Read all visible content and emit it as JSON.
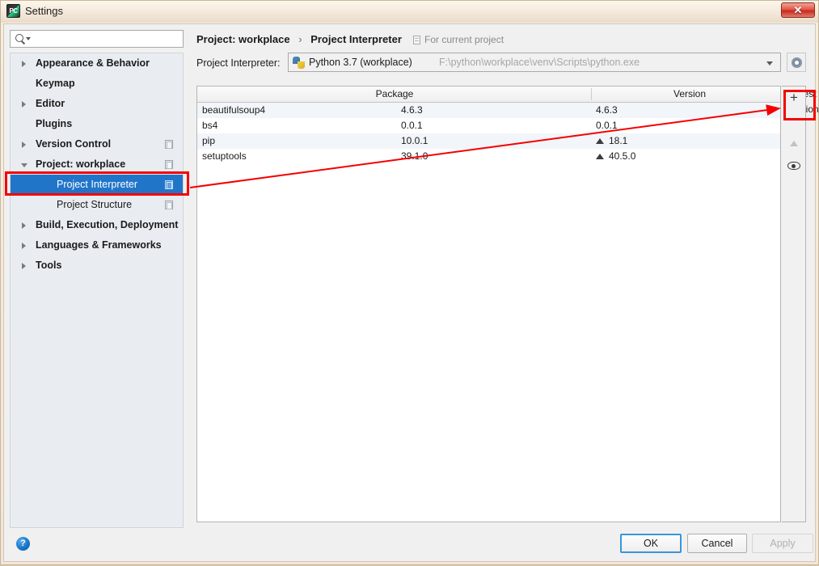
{
  "window": {
    "title": "Settings",
    "app_icon": "pycharm-icon",
    "close_label": "✕"
  },
  "sidebar": {
    "search": {
      "placeholder": "",
      "value": "",
      "icon": "search-icon"
    },
    "items": [
      {
        "label": "Appearance & Behavior",
        "level": 0,
        "arrow": "collapsed",
        "bold": true,
        "scope_icon": false,
        "selected": false
      },
      {
        "label": "Keymap",
        "level": 0,
        "arrow": "none",
        "bold": true,
        "scope_icon": false,
        "selected": false
      },
      {
        "label": "Editor",
        "level": 0,
        "arrow": "collapsed",
        "bold": true,
        "scope_icon": false,
        "selected": false
      },
      {
        "label": "Plugins",
        "level": 0,
        "arrow": "none",
        "bold": true,
        "scope_icon": false,
        "selected": false
      },
      {
        "label": "Version Control",
        "level": 0,
        "arrow": "collapsed",
        "bold": true,
        "scope_icon": true,
        "selected": false
      },
      {
        "label": "Project: workplace",
        "level": 0,
        "arrow": "expanded",
        "bold": true,
        "scope_icon": true,
        "selected": false
      },
      {
        "label": "Project Interpreter",
        "level": 1,
        "arrow": "none",
        "bold": false,
        "scope_icon": true,
        "selected": true
      },
      {
        "label": "Project Structure",
        "level": 1,
        "arrow": "none",
        "bold": false,
        "scope_icon": true,
        "selected": false
      },
      {
        "label": "Build, Execution, Deployment",
        "level": 0,
        "arrow": "collapsed",
        "bold": true,
        "scope_icon": false,
        "selected": false
      },
      {
        "label": "Languages & Frameworks",
        "level": 0,
        "arrow": "collapsed",
        "bold": true,
        "scope_icon": false,
        "selected": false
      },
      {
        "label": "Tools",
        "level": 0,
        "arrow": "collapsed",
        "bold": true,
        "scope_icon": false,
        "selected": false
      }
    ]
  },
  "main": {
    "breadcrumb": {
      "parent": "Project: workplace",
      "separator": "›",
      "current": "Project Interpreter"
    },
    "scope_note": "For current project",
    "interpreter": {
      "label": "Project Interpreter:",
      "name": "Python 3.7 (workplace)",
      "path": "F:\\python\\workplace\\venv\\Scripts\\python.exe",
      "icon": "python-icon",
      "settings_icon": "gear-icon"
    },
    "packages_table": {
      "columns": [
        "Package",
        "Version",
        "Latest version"
      ],
      "rows": [
        {
          "package": "beautifulsoup4",
          "version": "4.6.3",
          "latest": "4.6.3",
          "upgradable": false
        },
        {
          "package": "bs4",
          "version": "0.0.1",
          "latest": "0.0.1",
          "upgradable": false
        },
        {
          "package": "pip",
          "version": "10.0.1",
          "latest": "18.1",
          "upgradable": true
        },
        {
          "package": "setuptools",
          "version": "39.1.0",
          "latest": "40.5.0",
          "upgradable": true
        }
      ]
    },
    "table_tools": [
      {
        "name": "add-package-button",
        "glyph": "+",
        "enabled": true
      },
      {
        "name": "remove-package-button",
        "glyph": "−",
        "enabled": false
      },
      {
        "name": "upgrade-package-button",
        "glyph": "▲",
        "enabled": false
      },
      {
        "name": "show-early-releases-button",
        "glyph": "◉",
        "enabled": true
      }
    ]
  },
  "footer": {
    "help": "?",
    "ok": "OK",
    "cancel": "Cancel",
    "apply": "Apply"
  },
  "annotations": {
    "accent_color": "#f40000",
    "highlight_sidebar_item": "Project Interpreter",
    "highlight_toolbar_button": "+"
  }
}
